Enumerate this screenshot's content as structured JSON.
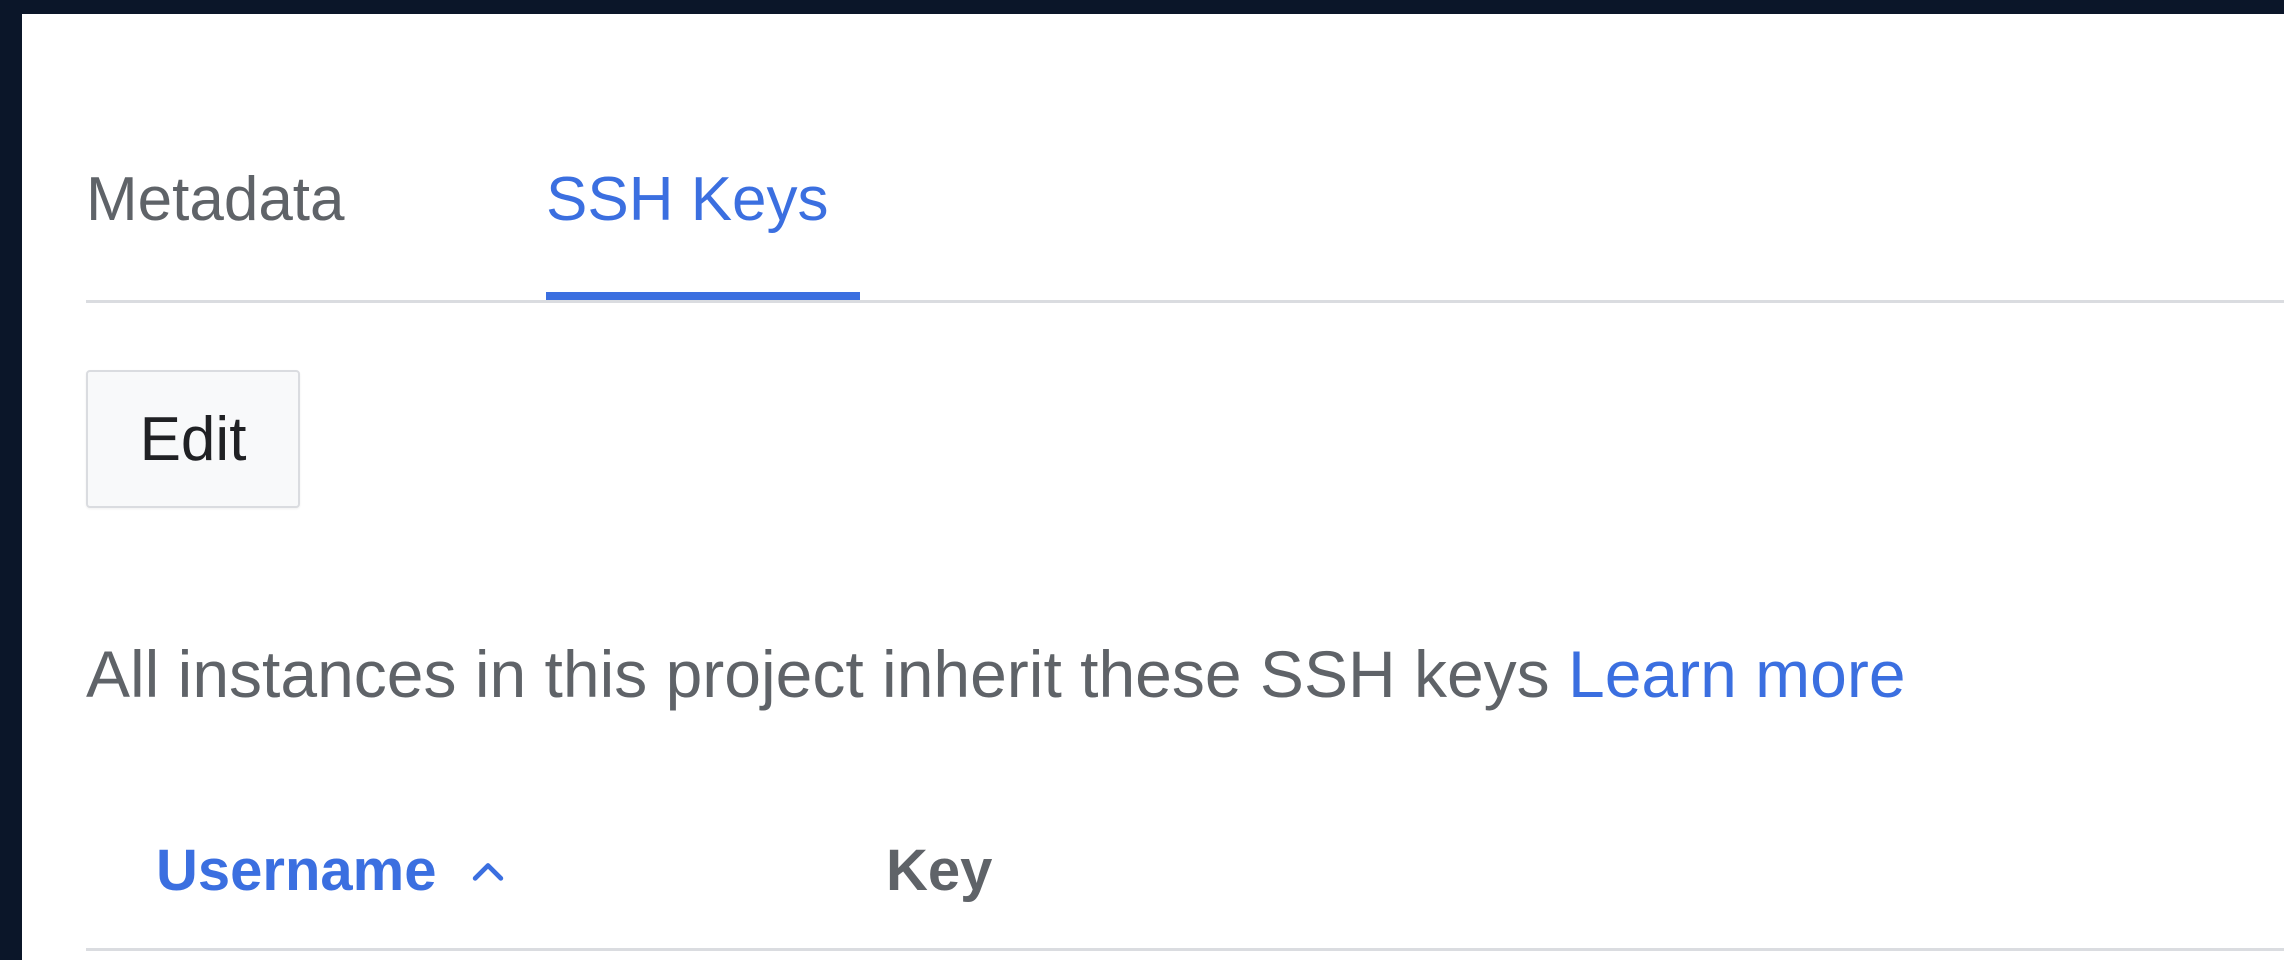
{
  "tabs": [
    {
      "label": "Metadata",
      "active": false
    },
    {
      "label": "SSH Keys",
      "active": true
    }
  ],
  "toolbar": {
    "edit_label": "Edit"
  },
  "info": {
    "text": "All instances in this project inherit these SSH keys ",
    "link_label": "Learn more"
  },
  "table": {
    "columns": [
      {
        "label": "Username",
        "sorted": "ascending",
        "sort_icon": "chevron-up-icon"
      },
      {
        "label": "Key"
      }
    ]
  },
  "colors": {
    "accent": "#3b6fe0",
    "text_secondary": "#5f6368",
    "divider": "#dadce0",
    "frame": "#0b1629"
  }
}
